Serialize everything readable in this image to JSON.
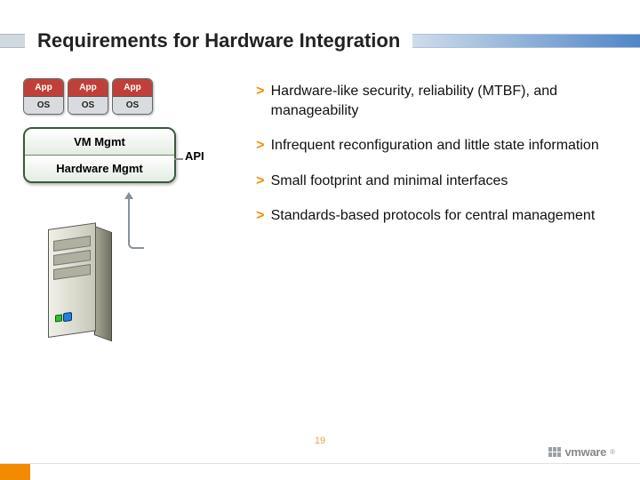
{
  "title": "Requirements for Hardware Integration",
  "app_blocks": [
    {
      "top": "App",
      "bot": "OS"
    },
    {
      "top": "App",
      "bot": "OS"
    },
    {
      "top": "App",
      "bot": "OS"
    }
  ],
  "mgmt": {
    "vm": "VM Mgmt",
    "hw": "Hardware Mgmt"
  },
  "api_label": "API",
  "bullets": [
    "Hardware-like security, reliability (MTBF), and manageability",
    "Infrequent reconfiguration and little state information",
    "Small footprint and minimal interfaces",
    "Standards-based protocols for central management"
  ],
  "footer": {
    "page": "19",
    "brand": "vmware"
  }
}
